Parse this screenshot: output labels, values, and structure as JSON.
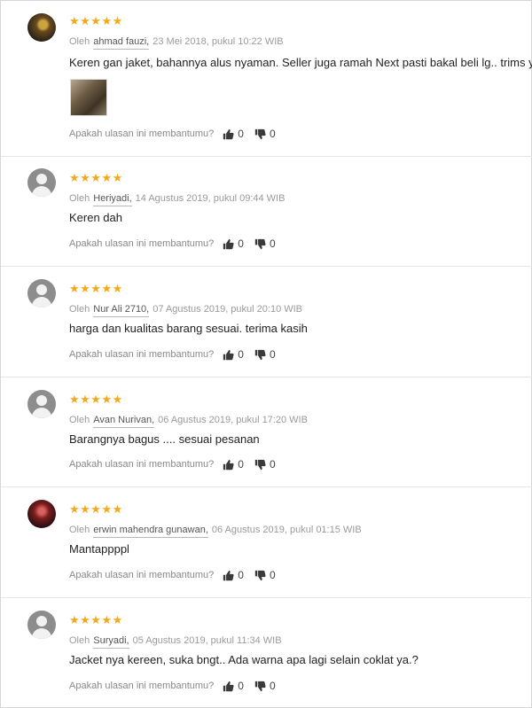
{
  "helpful_question": "Apakah ulasan ini membantumu?",
  "by_label": "Oleh",
  "colors": {
    "star": "#f4a81d",
    "meta": "#9a9a9a"
  },
  "reviews": [
    {
      "stars": "★★★★★",
      "user": "ahmad fauzi,",
      "date": "23 Mei 2018, pukul 10:22 WIB",
      "text": "Keren gan jaket, bahannya alus nyaman. Seller juga ramah Next pasti bakal beli lg.. trims y",
      "has_photo": true,
      "likes": "0",
      "dislikes": "0"
    },
    {
      "stars": "★★★★★",
      "user": "Heriyadi,",
      "date": "14 Agustus 2019, pukul 09:44 WIB",
      "text": "Keren dah",
      "likes": "0",
      "dislikes": "0"
    },
    {
      "stars": "★★★★★",
      "user": "Nur Ali 2710,",
      "date": "07 Agustus 2019, pukul 20:10 WIB",
      "text": "harga dan kualitas barang sesuai. terima kasih",
      "likes": "0",
      "dislikes": "0"
    },
    {
      "stars": "★★★★★",
      "user": "Avan Nurivan,",
      "date": "06 Agustus 2019, pukul 17:20 WIB",
      "text": "Barangnya bagus .... sesuai pesanan",
      "likes": "0",
      "dislikes": "0"
    },
    {
      "stars": "★★★★★",
      "user": "erwin mahendra gunawan,",
      "date": "06 Agustus 2019, pukul 01:15 WIB",
      "text": "Mantappppl",
      "likes": "0",
      "dislikes": "0"
    },
    {
      "stars": "★★★★★",
      "user": "Suryadi,",
      "date": "05 Agustus 2019, pukul 11:34 WIB",
      "text": "Jacket nya kereen, suka bngt.. Ada warna apa lagi selain coklat ya.?",
      "likes": "0",
      "dislikes": "0"
    }
  ]
}
